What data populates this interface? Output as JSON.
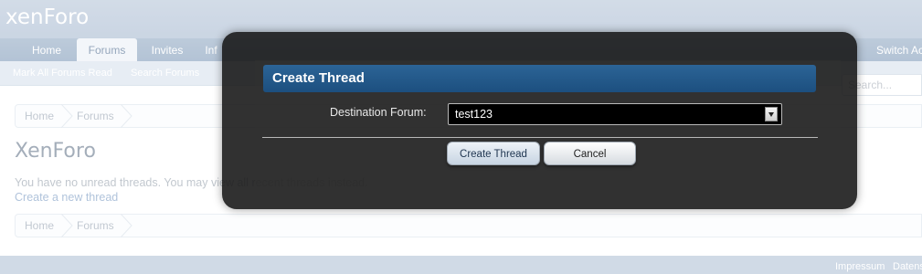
{
  "header": {
    "logo": "xenForo",
    "tabs": [
      {
        "label": "Home",
        "active": false
      },
      {
        "label": "Forums",
        "active": true
      },
      {
        "label": "Invites",
        "active": false
      },
      {
        "label": "Inf",
        "active": false
      }
    ],
    "switch_label": "Switch Ac"
  },
  "subnav": {
    "links": [
      "Mark All Forums Read",
      "Search Forums"
    ]
  },
  "search": {
    "placeholder": "Search..."
  },
  "breadcrumb": {
    "items": [
      "Home",
      "Forums"
    ]
  },
  "page": {
    "title": "XenForo",
    "notice": "You have no unread threads. You may view all recent threads instead.",
    "create_link": "Create a new thread"
  },
  "footer": {
    "links": [
      "Impressum",
      "Datens"
    ]
  },
  "dialog": {
    "title": "Create Thread",
    "field_label": "Destination Forum:",
    "selected_forum": "test123",
    "primary_button": "Create Thread",
    "cancel_button": "Cancel"
  }
}
